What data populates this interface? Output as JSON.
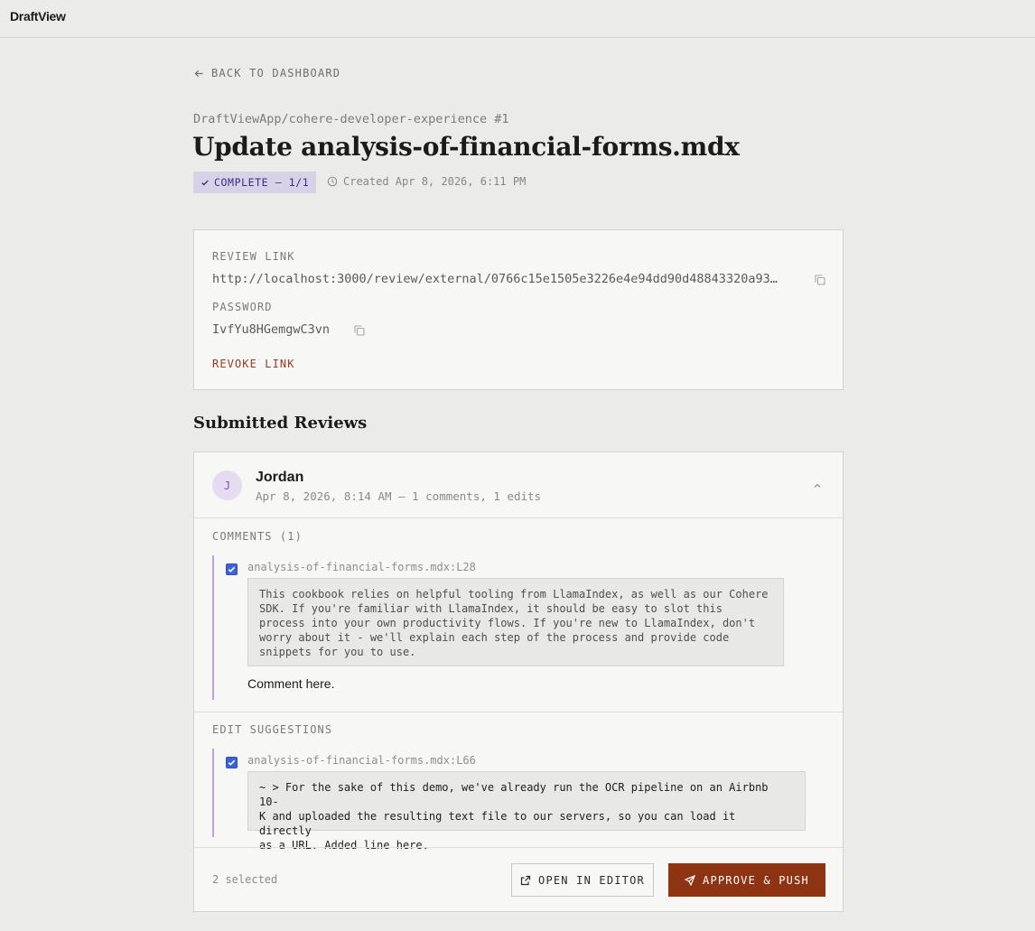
{
  "app": {
    "brand": "DraftView"
  },
  "nav": {
    "back_label": "BACK TO DASHBOARD"
  },
  "pr": {
    "repo_ref": "DraftViewApp/cohere-developer-experience #1",
    "title": "Update analysis-of-financial-forms.mdx",
    "status_label": "COMPLETE — 1/1",
    "created_label": "Created Apr 8, 2026, 6:11 PM"
  },
  "review_link": {
    "label": "REVIEW LINK",
    "url": "http://localhost:3000/review/external/0766c15e1505e3226e4e94dd90d48843320a93…",
    "password_label": "PASSWORD",
    "password": "IvfYu8HGemgwC3vn",
    "revoke_label": "REVOKE LINK"
  },
  "reviews": {
    "section_title": "Submitted Reviews",
    "items": [
      {
        "avatar_initial": "J",
        "reviewer": "Jordan",
        "meta": "Apr 8, 2026, 8:14 AM — 1 comments, 1 edits",
        "comments_label": "COMMENTS (1)",
        "comments": [
          {
            "checked": true,
            "file_ref": "analysis-of-financial-forms.mdx:L28",
            "quote": "This cookbook relies on helpful tooling from LlamaIndex, as well as our Cohere\nSDK. If you're familiar with LlamaIndex, it should be easy to slot this\nprocess into your own productivity flows. If you're new to LlamaIndex, don't\nworry about it - we'll explain each step of the process and provide code\nsnippets for you to use.",
            "text": "Comment here."
          }
        ],
        "edits_label": "EDIT SUGGESTIONS",
        "edits": [
          {
            "checked": true,
            "file_ref": "analysis-of-financial-forms.mdx:L66",
            "diff": "~ > For the sake of this demo, we've already run the OCR pipeline on an Airbnb 10-\nK and uploaded the resulting text file to our servers, so you can load it directly\nas a URL. Added line here."
          }
        ],
        "selected_label": "2 selected",
        "open_editor_label": "OPEN IN EDITOR",
        "approve_label": "APPROVE & PUSH"
      }
    ]
  },
  "colors": {
    "accent_primary": "#8f3413",
    "status_badge_bg": "#d7d2e6",
    "status_badge_fg": "#3d2a8a",
    "checkbox": "#3c62d6",
    "thread_line": "#b9a3df"
  },
  "icons": {
    "back": "arrow-left-icon",
    "status": "check-icon",
    "created": "clock-icon",
    "copy": "copy-icon",
    "collapse": "chevron-up-icon",
    "open_editor": "external-link-icon",
    "approve": "send-icon"
  }
}
